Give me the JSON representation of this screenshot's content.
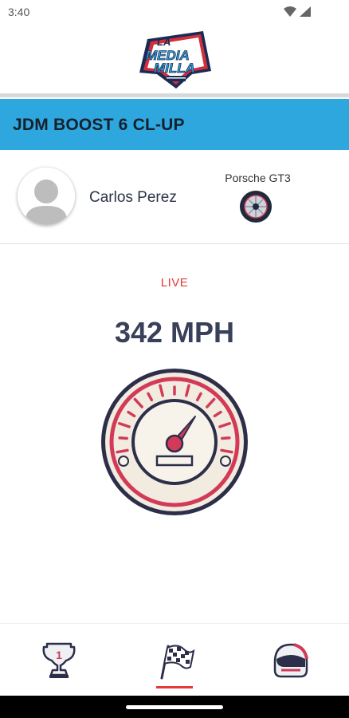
{
  "status_bar": {
    "time": "3:40",
    "icons": [
      "wifi-icon",
      "signal-icon"
    ]
  },
  "header": {
    "logo": {
      "name": "La Media Milla",
      "line1": "LA",
      "line2": "MEDIA",
      "line3": "MILLA"
    }
  },
  "event": {
    "title": "JDM BOOST 6 CL-UP"
  },
  "driver": {
    "name": "Carlos Perez",
    "car": "Porsche GT3"
  },
  "race": {
    "status": "LIVE",
    "speed": "342 MPH"
  },
  "nav": {
    "items": [
      {
        "name": "leaderboard",
        "icon": "trophy-icon",
        "badge": "1"
      },
      {
        "name": "race",
        "icon": "checkered-flag-icon",
        "active": true
      },
      {
        "name": "profile",
        "icon": "helmet-icon"
      }
    ]
  },
  "colors": {
    "accent": "#2ea7de",
    "live": "#e53935",
    "gauge": "#d23a58",
    "text": "#39405a"
  }
}
